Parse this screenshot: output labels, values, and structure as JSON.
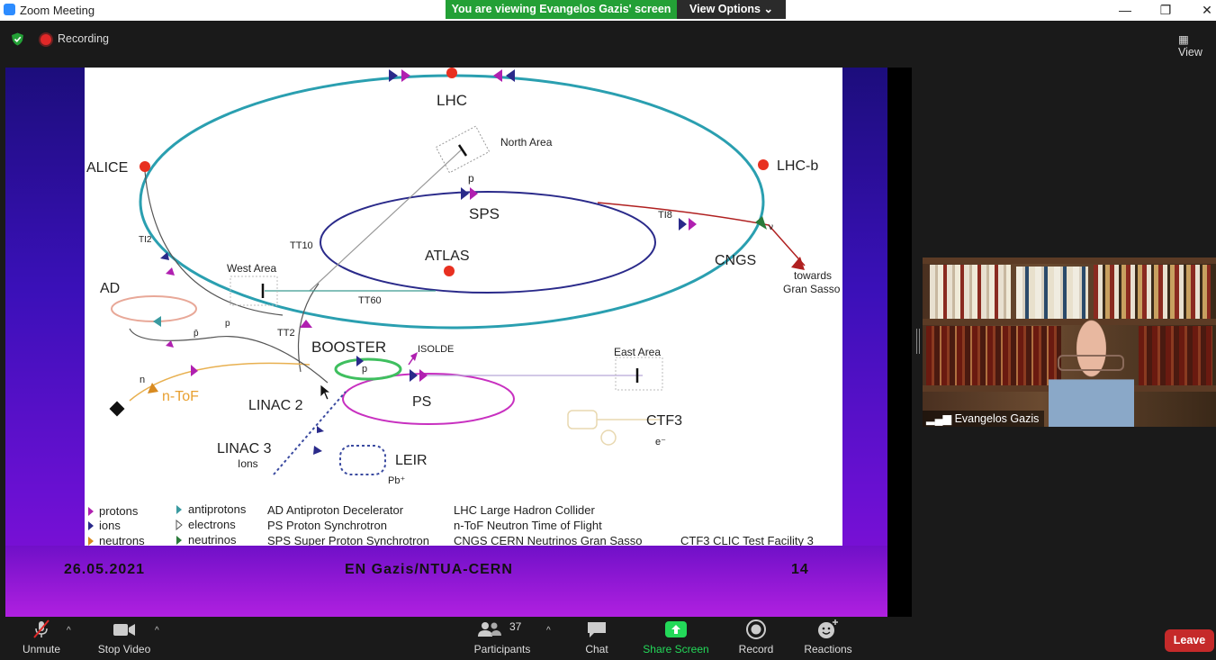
{
  "window": {
    "title": "Zoom Meeting"
  },
  "banner": {
    "viewing": "You are viewing Evangelos Gazis' screen",
    "view_options": "View Options"
  },
  "topbar": {
    "recording": "Recording",
    "view": "View"
  },
  "slide": {
    "labels": {
      "lhc": "LHC",
      "alice": "ALICE",
      "lhcb": "LHC-b",
      "north_area": "North Area",
      "p": "p",
      "sps": "SPS",
      "ti8": "TI8",
      "nu": "ν",
      "cngs": "CNGS",
      "towards": "towards",
      "gran_sasso": "Gran Sasso",
      "ti2": "TI2",
      "tt10": "TT10",
      "atlas": "ATLAS",
      "west_area": "West Area",
      "tt60": "TT60",
      "ad": "AD",
      "p_bar": "p̄",
      "tt2": "TT2",
      "booster": "BOOSTER",
      "isolde": "ISOLDE",
      "east_area": "East Area",
      "n": "n",
      "ntof": "n-ToF",
      "linac2": "LINAC 2",
      "ps": "PS",
      "ctf3": "CTF3",
      "e_minus": "e⁻",
      "linac3": "LINAC 3",
      "ions": "Ions",
      "leir": "LEIR",
      "pb": "Pb⁺"
    },
    "legend": {
      "protons": "protons",
      "ions": "ions",
      "neutrons": "neutrons",
      "antiprotons": "antiprotons",
      "electrons": "electrons",
      "neutrinos": "neutrinos",
      "ad_def": "AD Antiproton Decelerator",
      "ps_def": "PS   Proton Synchrotron",
      "sps_def": "SPS Super Proton Synchrotron",
      "lhc_def": "LHC Large Hadron Collider",
      "ntof_def": "n-ToF Neutron Time of Flight",
      "cngs_def": "CNGS CERN Neutrinos Gran Sasso",
      "ctf3_def": "CTF3 CLIC Test Facility 3"
    },
    "footer": {
      "date": "26.05.2021",
      "author": "EN Gazis/NTUA-CERN",
      "page": "14"
    }
  },
  "participant": {
    "name": "Evangelos Gazis"
  },
  "toolbar": {
    "unmute": "Unmute",
    "stop_video": "Stop Video",
    "participants": "Participants",
    "participants_count": "37",
    "chat": "Chat",
    "share_screen": "Share Screen",
    "record": "Record",
    "reactions": "Reactions",
    "leave": "Leave"
  },
  "colors": {
    "banner_green": "#23a036",
    "leave_red": "#c52a2a",
    "share_green": "#23d959",
    "lhc_ring": "#2a9fb0",
    "sps_ring": "#2a2a8a",
    "ps_ring": "#c830c0"
  }
}
